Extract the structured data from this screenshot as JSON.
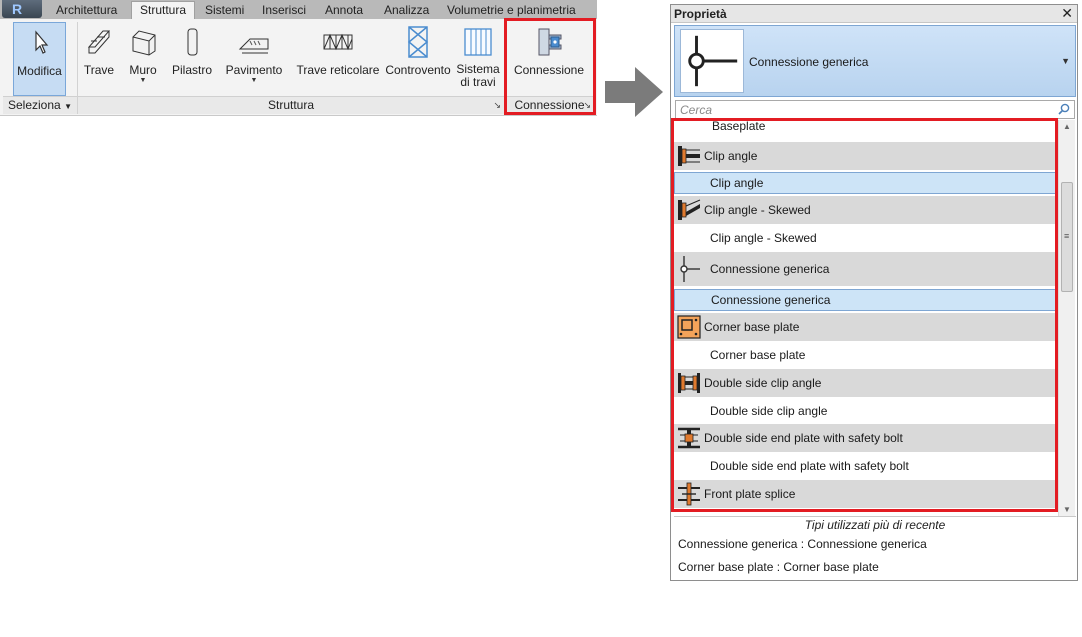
{
  "ribbon": {
    "tabs": [
      "Architettura",
      "Struttura",
      "Sistemi",
      "Inserisci",
      "Annota",
      "Analizza",
      "Volumetrie e planimetria"
    ],
    "active_tab": "Struttura",
    "buttons": {
      "modifica": "Modifica",
      "trave": "Trave",
      "muro": "Muro",
      "pilastro": "Pilastro",
      "pavimento": "Pavimento",
      "trave_reticolare": "Trave reticolare",
      "controvento": "Controvento",
      "sistema_line1": "Sistema",
      "sistema_line2": "di travi",
      "connessione": "Connessione"
    },
    "panels": {
      "seleziona": "Seleziona",
      "struttura": "Struttura",
      "connessione": "Connessione"
    }
  },
  "properties": {
    "title": "Proprietà",
    "selected_type": "Connessione generica",
    "search_placeholder": "Cerca",
    "list": [
      {
        "label": "Baseplate",
        "kind": "type"
      },
      {
        "label": "Clip angle",
        "kind": "family",
        "icon": "clip-angle-icon"
      },
      {
        "label": "Clip angle",
        "kind": "type",
        "highlighted": true
      },
      {
        "label": "Clip angle - Skewed",
        "kind": "family",
        "icon": "clip-angle-skewed-icon"
      },
      {
        "label": "Clip angle - Skewed",
        "kind": "type"
      },
      {
        "label": "Connessione generica",
        "kind": "family",
        "icon": "generic-connection-icon"
      },
      {
        "label": "Connessione generica",
        "kind": "type",
        "highlighted": true
      },
      {
        "label": "Corner base plate",
        "kind": "family",
        "icon": "corner-base-plate-icon"
      },
      {
        "label": "Corner base plate",
        "kind": "type"
      },
      {
        "label": "Double side clip angle",
        "kind": "family",
        "icon": "double-clip-angle-icon"
      },
      {
        "label": "Double side clip angle",
        "kind": "type"
      },
      {
        "label": "Double side end plate with safety bolt",
        "kind": "family",
        "icon": "double-end-plate-icon"
      },
      {
        "label": "Double side end plate with safety bolt",
        "kind": "type"
      },
      {
        "label": "Front plate splice",
        "kind": "family",
        "icon": "front-plate-splice-icon"
      }
    ],
    "recent_header": "Tipi utilizzati più di recente",
    "recent": [
      "Connessione generica : Connessione generica",
      "Corner base plate : Corner base plate"
    ]
  },
  "colors": {
    "highlight_box": "#e31c23",
    "selection_blue": "#cde4f7",
    "family_row_gray": "#d9d9d9"
  }
}
